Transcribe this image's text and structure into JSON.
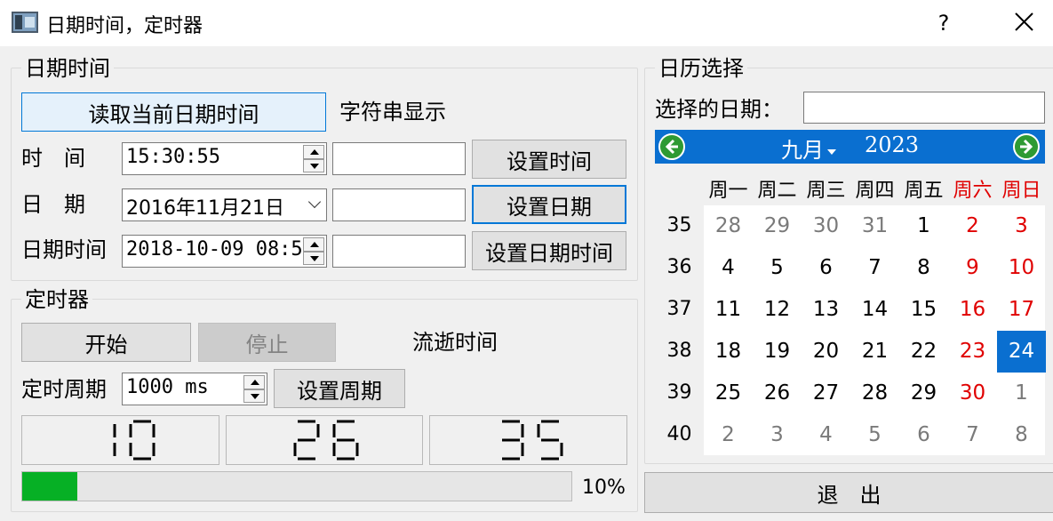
{
  "window": {
    "title": "日期时间，定时器",
    "help": "?"
  },
  "datetime_group": {
    "title": "日期时间",
    "read_button": "读取当前日期时间",
    "string_display_label": "字符串显示",
    "time_label": "时　间",
    "time_value": "15:30:55",
    "date_label": "日　期",
    "date_value": "2016年11月21日",
    "datetime_label": "日期时间",
    "datetime_value": "2018-10-09 08:5",
    "time_text": "",
    "date_text": "",
    "datetime_text": "",
    "set_time_button": "设置时间",
    "set_date_button": "设置日期",
    "set_datetime_button": "设置日期时间"
  },
  "timer_group": {
    "title": "定时器",
    "start_button": "开始",
    "stop_button": "停止",
    "elapsed_label": "流逝时间",
    "period_label": "定时周期",
    "period_value": "1000 ms",
    "set_period_button": "设置周期",
    "lcd": [
      "10",
      "26",
      "35"
    ],
    "progress_percent": 10,
    "progress_text": "10%",
    "progress_color": "#06b025"
  },
  "calendar_group": {
    "title": "日历选择",
    "selected_date_label": "选择的日期：",
    "selected_date_value": "",
    "month": "九月",
    "year": "2023",
    "weekday_headers": [
      "周一",
      "周二",
      "周三",
      "周四",
      "周五",
      "周六",
      "周日"
    ],
    "week_numbers": [
      "35",
      "36",
      "37",
      "38",
      "39",
      "40"
    ],
    "weeks": [
      [
        "28",
        "29",
        "30",
        "31",
        "1",
        "2",
        "3"
      ],
      [
        "4",
        "5",
        "6",
        "7",
        "8",
        "9",
        "10"
      ],
      [
        "11",
        "12",
        "13",
        "14",
        "15",
        "16",
        "17"
      ],
      [
        "18",
        "19",
        "20",
        "21",
        "22",
        "23",
        "24"
      ],
      [
        "25",
        "26",
        "27",
        "28",
        "29",
        "30",
        "1"
      ],
      [
        "2",
        "3",
        "4",
        "5",
        "6",
        "7",
        "8"
      ]
    ],
    "selected_day": "24",
    "accent_color": "#0a6fd0",
    "weekend_color": "#e00000"
  },
  "exit_button": "退　出"
}
